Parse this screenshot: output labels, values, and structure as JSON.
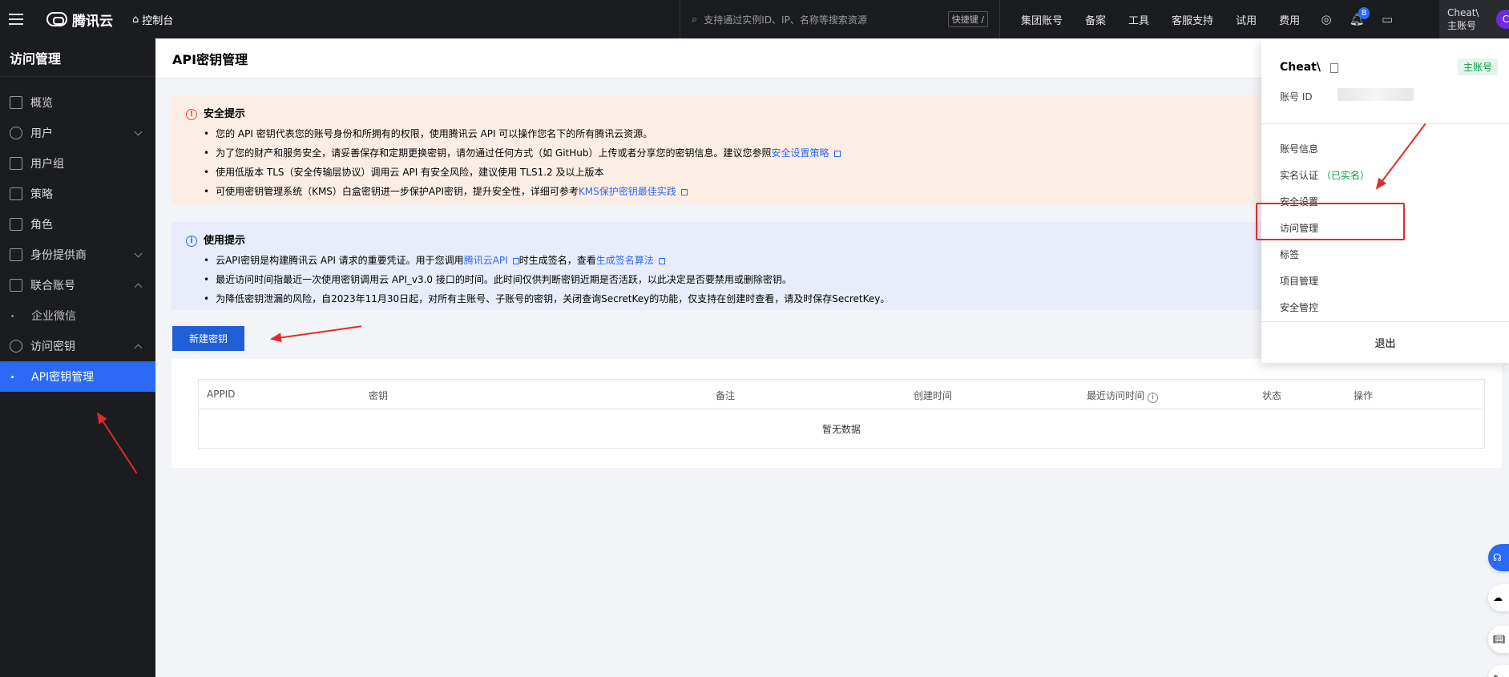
{
  "topbar": {
    "brand": "腾讯云",
    "console": "控制台",
    "search_placeholder": "支持通过实例ID、IP、名称等搜索资源",
    "shortcut": "快捷键 /",
    "nav": [
      "集团账号",
      "备案",
      "工具",
      "客服支持",
      "试用",
      "费用"
    ],
    "notification_count": "8",
    "account_name": "Cheat\\",
    "account_type": "主账号",
    "avatar_letter": "C"
  },
  "sidebar": {
    "title": "访问管理",
    "items": [
      {
        "label": "概览"
      },
      {
        "label": "用户"
      },
      {
        "label": "用户组"
      },
      {
        "label": "策略"
      },
      {
        "label": "角色"
      },
      {
        "label": "身份提供商"
      },
      {
        "label": "联合账号"
      },
      {
        "label": "企业微信"
      },
      {
        "label": "访问密钥"
      },
      {
        "label": "API密钥管理"
      }
    ]
  },
  "page": {
    "title": "API密钥管理"
  },
  "security_tip": {
    "title": "安全提示",
    "lines": [
      "您的 API 密钥代表您的账号身份和所拥有的权限，使用腾讯云 API 可以操作您名下的所有腾讯云资源。",
      "为了您的财产和服务安全，请妥善保存和定期更换密钥，请勿通过任何方式（如 GitHub）上传或者分享您的密钥信息。建议您参照",
      "使用低版本 TLS（安全传输层协议）调用云 API 有安全风险，建议使用 TLS1.2 及以上版本",
      "可使用密钥管理系统（KMS）白盒密钥进一步保护API密钥，提升安全性，详细可参考"
    ],
    "link1": "安全设置策略",
    "link2": "KMS保护密钥最佳实践"
  },
  "usage_tip": {
    "title": "使用提示",
    "line1_pre": "云API密钥是构建腾讯云 API 请求的重要凭证。用于您调用",
    "line1_link1": "腾讯云API",
    "line1_mid": "时生成签名，查看",
    "line1_link2": "生成签名算法",
    "line2": "最近访问时间指最近一次使用密钥调用云 API_v3.0 接口的时间。此时间仅供判断密钥近期是否活跃，以此决定是否要禁用或删除密钥。",
    "line3": "为降低密钥泄漏的风险，自2023年11月30日起，对所有主账号、子账号的密钥，关闭查询SecretKey的功能，仅支持在创建时查看，请及时保存SecretKey。"
  },
  "create_button": "新建密钥",
  "table": {
    "headers": [
      "APPID",
      "密钥",
      "备注",
      "创建时间",
      "最近访问时间",
      "状态",
      "操作"
    ],
    "empty": "暂无数据"
  },
  "dropdown": {
    "user": "Cheat\\",
    "tag": "主账号",
    "id_label": "账号 ID",
    "items": [
      "账号信息",
      "实名认证",
      "安全设置",
      "访问管理",
      "标签",
      "项目管理",
      "安全管控"
    ],
    "verified": "（已实名）",
    "logout": "退出"
  }
}
